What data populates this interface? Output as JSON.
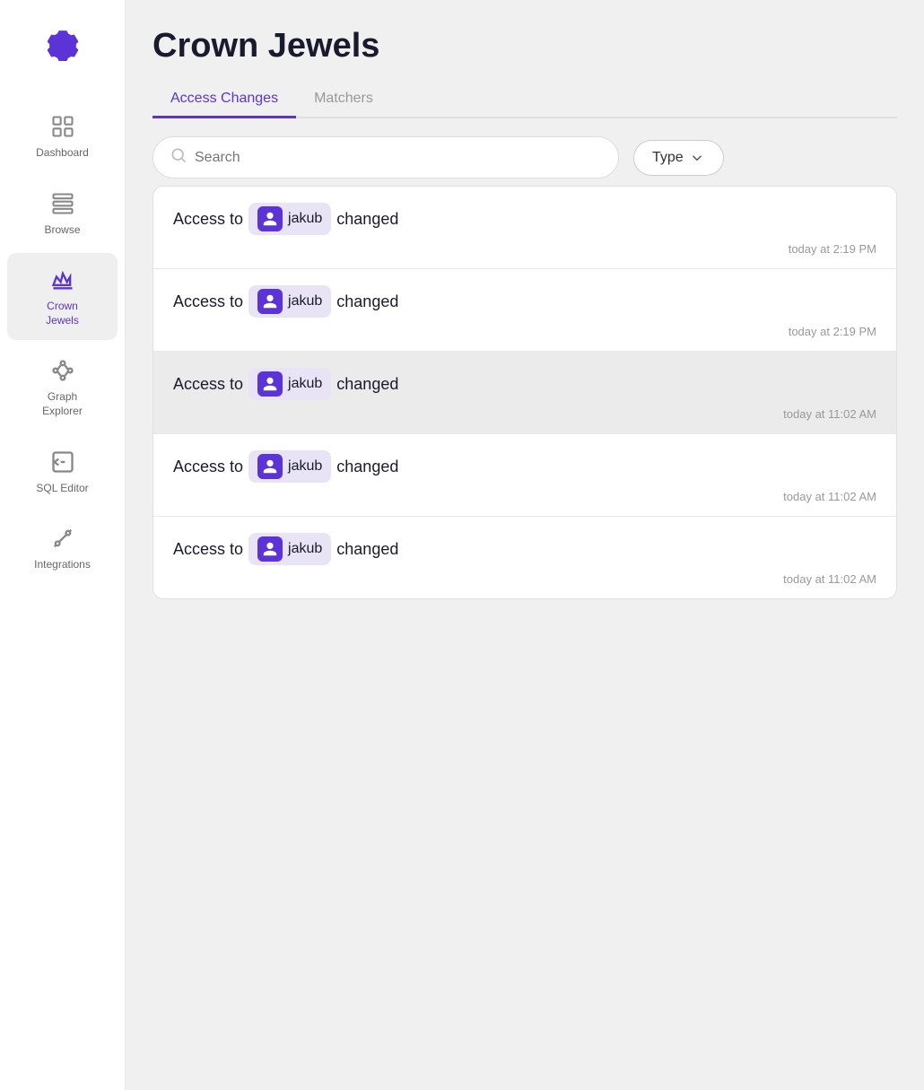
{
  "sidebar": {
    "items": [
      {
        "id": "dashboard",
        "label": "Dashboard",
        "icon": "dashboard-icon",
        "active": false
      },
      {
        "id": "browse",
        "label": "Browse",
        "icon": "browse-icon",
        "active": false
      },
      {
        "id": "crown-jewels",
        "label": "Crown\nJewels",
        "icon": "crown-icon",
        "active": true
      },
      {
        "id": "graph-explorer",
        "label": "Graph\nExplorer",
        "icon": "graph-icon",
        "active": false
      },
      {
        "id": "sql-editor",
        "label": "SQL Editor",
        "icon": "sql-icon",
        "active": false
      },
      {
        "id": "integrations",
        "label": "Integrations",
        "icon": "integrations-icon",
        "active": false
      }
    ]
  },
  "page": {
    "title": "Crown Jewels",
    "tabs": [
      {
        "id": "access-changes",
        "label": "Access Changes",
        "active": true
      },
      {
        "id": "matchers",
        "label": "Matchers",
        "active": false
      }
    ]
  },
  "search": {
    "placeholder": "Search",
    "value": ""
  },
  "filter": {
    "label": "Type"
  },
  "rows": [
    {
      "id": 1,
      "prefix": "Access to",
      "user": "jakub",
      "suffix": "changed",
      "time": "today at 2:19 PM",
      "highlighted": false
    },
    {
      "id": 2,
      "prefix": "Access to",
      "user": "jakub",
      "suffix": "changed",
      "time": "today at 2:19 PM",
      "highlighted": false
    },
    {
      "id": 3,
      "prefix": "Access to",
      "user": "jakub",
      "suffix": "changed",
      "time": "today at 11:02 AM",
      "highlighted": true
    },
    {
      "id": 4,
      "prefix": "Access to",
      "user": "jakub",
      "suffix": "changed",
      "time": "today at 11:02 AM",
      "highlighted": false
    },
    {
      "id": 5,
      "prefix": "Access to",
      "user": "jakub",
      "suffix": "changed",
      "time": "today at 11:02 AM",
      "highlighted": false
    }
  ]
}
